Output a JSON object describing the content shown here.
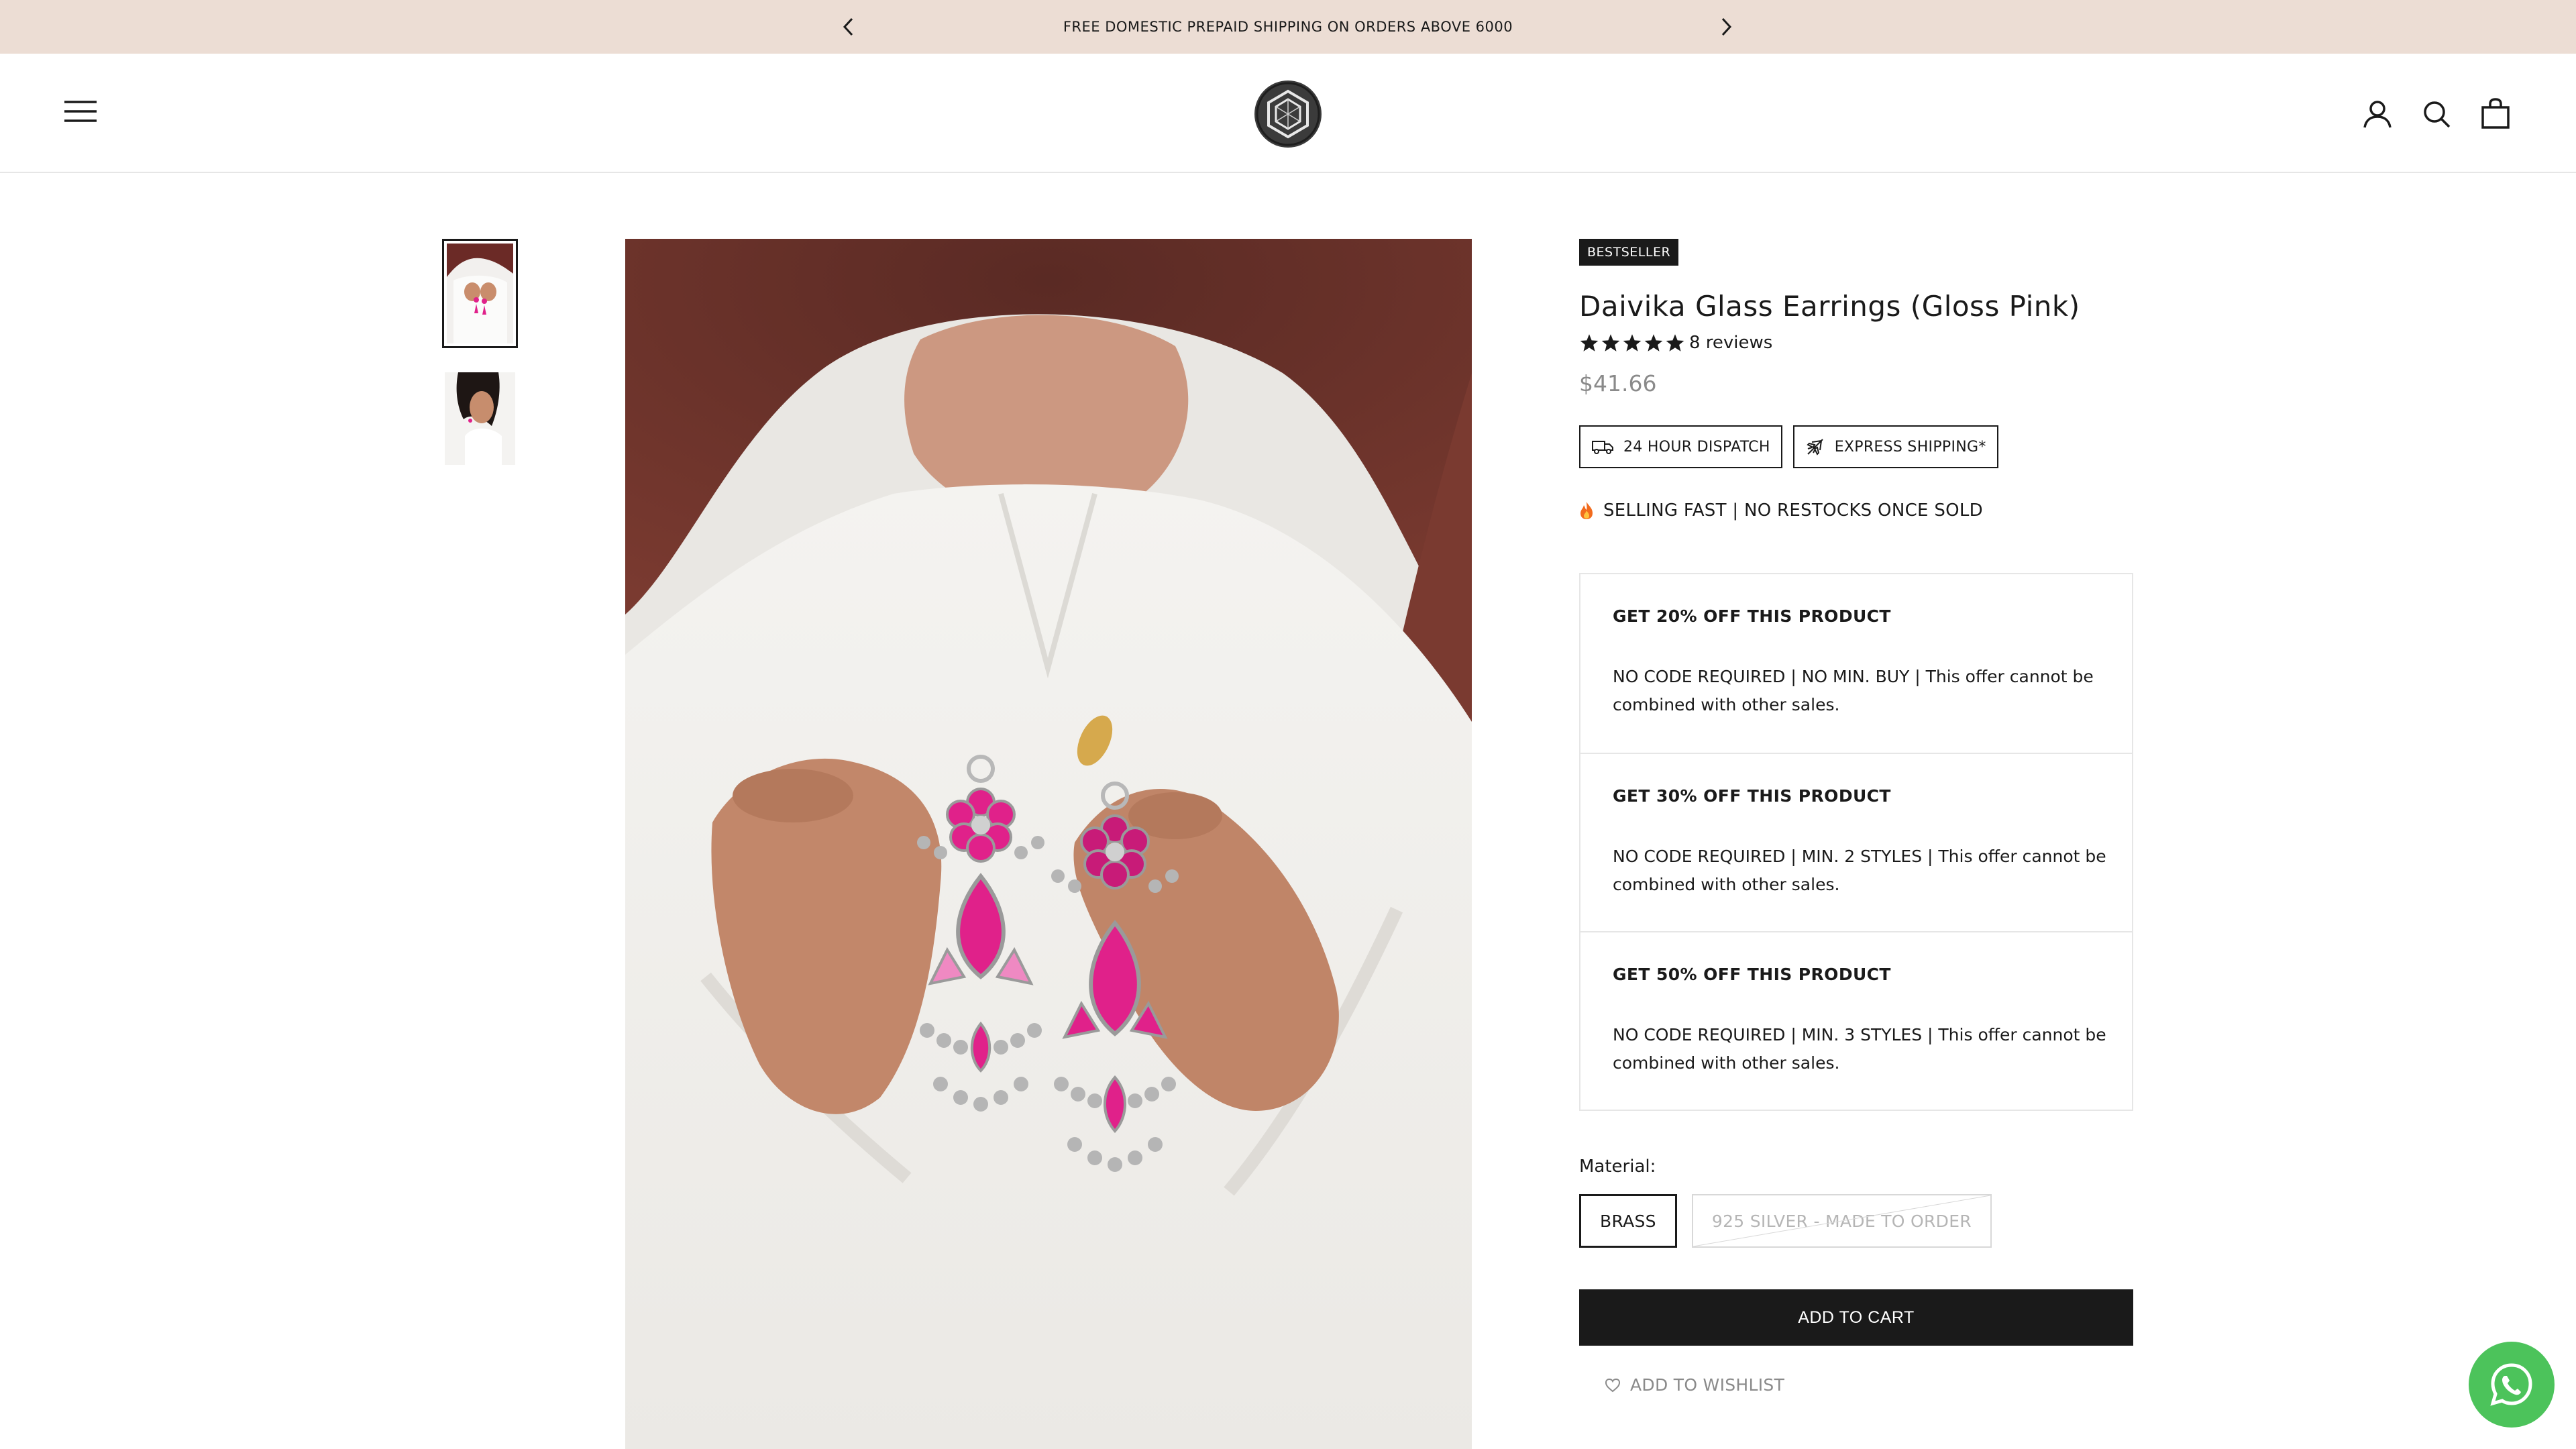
{
  "announcement": {
    "text": "FREE DOMESTIC PREPAID SHIPPING ON ORDERS ABOVE 6000",
    "prev_icon": "chevron-left-icon",
    "next_icon": "chevron-right-icon",
    "background": "#ecddd4"
  },
  "header": {
    "menu_icon": "hamburger-menu-icon",
    "logo": "hexagon-logo",
    "account_icon": "user-account-icon",
    "search_icon": "search-icon",
    "cart_icon": "shopping-bag-icon"
  },
  "gallery": {
    "thumbnails": [
      "earrings-held-in-hands",
      "model-wearing-earrings"
    ],
    "selected_index": 0
  },
  "product": {
    "badge": "BESTSELLER",
    "title": "Daivika Glass Earrings (Gloss Pink)",
    "rating": 5,
    "reviews": "8 reviews",
    "price": "$41.66",
    "tags": [
      {
        "label": "24 HOUR DISPATCH",
        "icon": "truck-icon"
      },
      {
        "label": "EXPRESS SHIPPING*",
        "icon": "airplane-icon"
      }
    ],
    "urgency": "SELLING FAST | NO RESTOCKS ONCE SOLD",
    "urgency_icon": "fire-icon",
    "offers": [
      {
        "title": "GET 20% OFF THIS PRODUCT",
        "description": "NO CODE REQUIRED | NO MIN. BUY | This offer cannot be combined with other sales."
      },
      {
        "title": "GET 30% OFF THIS PRODUCT",
        "description": "NO CODE REQUIRED | MIN. 2 STYLES | This offer cannot be combined with other sales."
      },
      {
        "title": "GET 50% OFF THIS PRODUCT",
        "description": "NO CODE REQUIRED | MIN. 3 STYLES | This offer cannot be combined with other sales."
      }
    ],
    "material_label": "Material:",
    "materials": [
      {
        "label": "BRASS",
        "state": "selected"
      },
      {
        "label": "925 SILVER - MADE TO ORDER",
        "state": "unavailable"
      }
    ],
    "add_to_cart": "ADD TO CART",
    "wishlist": "ADD TO WISHLIST",
    "wishlist_icon": "heart-icon"
  },
  "chat": {
    "icon": "whatsapp-icon",
    "color": "#4cc35b"
  }
}
